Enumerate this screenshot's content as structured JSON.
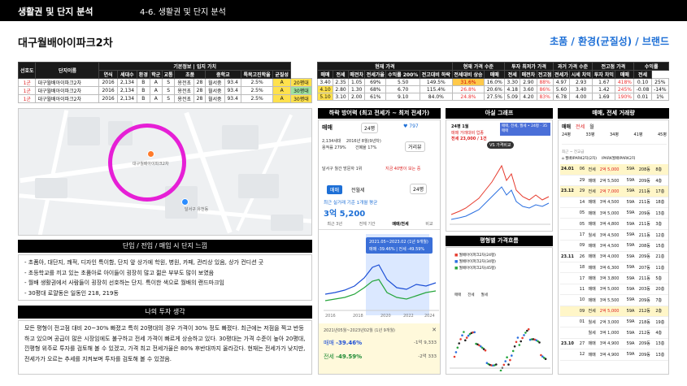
{
  "header": {
    "section": "생활권 및 단지 분석",
    "subsection": "4-6. 생활권 및 단지 분석"
  },
  "page_title": "대구월배아이파크2차",
  "brand_tag": "초품 / 환경(균질성) / 브랜드",
  "left_table": {
    "group_header": "기본정보 | 입지 가치",
    "headers": [
      "선호도",
      "단지이름",
      "연식",
      "세대수",
      "환경",
      "학군",
      "교통",
      "초품",
      "중학교",
      "학원가",
      "특목고진학율",
      "균질성",
      "평형"
    ],
    "rows": [
      {
        "pref": "1군",
        "name": "대구월배아이파크2차",
        "year": "2016",
        "units": "2,134",
        "env": "B",
        "school": "A",
        "traffic": "S",
        "elem": "용전초",
        "dist": "28",
        "middle": "월서중",
        "acad": "93.4",
        "rate": "2.5%",
        "homog": "A",
        "size": "20평대"
      },
      {
        "pref": "1군",
        "name": "대구월배아이파크2차",
        "year": "2016",
        "units": "2,134",
        "env": "B",
        "school": "A",
        "traffic": "S",
        "elem": "용전초",
        "dist": "28",
        "middle": "월서중",
        "acad": "93.4",
        "rate": "2.5%",
        "homog": "A",
        "size": "30평대"
      },
      {
        "pref": "1군",
        "name": "대구월배아이파크2차",
        "year": "2016",
        "units": "2,134",
        "env": "B",
        "school": "A",
        "traffic": "S",
        "elem": "용전초",
        "dist": "28",
        "middle": "월서중",
        "acad": "93.4",
        "rate": "2.5%",
        "homog": "A",
        "size": "30평대"
      }
    ]
  },
  "right_table": {
    "group_headers": [
      "현재 가격",
      "현재 가격 수준",
      "투자 최저가 가격",
      "과거 가격 수준",
      "전고점 가격",
      "수익률"
    ],
    "headers": [
      "매매",
      "전세",
      "매전차",
      "전세가율",
      "수익률 200%",
      "전고대비 하락",
      "전세대비 상승",
      "매매",
      "전세",
      "매전차",
      "전고점",
      "전세가",
      "시세 차익",
      "투자 차익",
      "매매",
      "전세"
    ],
    "rows": [
      [
        "3.40",
        "2.35",
        "1.05",
        "69%",
        "5.50",
        "149.5%",
        "31.6%",
        "16.0%",
        "3.30",
        "2.90",
        "88%",
        "4.97",
        "2.93",
        "1.67",
        "418%",
        "0.10",
        "25%"
      ],
      [
        "4.10",
        "2.80",
        "1.30",
        "68%",
        "6.70",
        "115.4%",
        "26.8%",
        "20.6%",
        "4.18",
        "3.60",
        "86%",
        "5.60",
        "3.40",
        "1.42",
        "245%",
        "-0.08",
        "-14%"
      ],
      [
        "5.10",
        "3.10",
        "2.00",
        "61%",
        "9.10",
        "84.0%",
        "24.8%",
        "27.5%",
        "5.09",
        "4.20",
        "83%",
        "6.78",
        "4.00",
        "1.69",
        "190%",
        "0.01",
        "1%"
      ]
    ]
  },
  "map": {
    "label1": "달서구 유천동",
    "pin_label": "대구월배아이파크2차"
  },
  "feelings": {
    "title": "단임 / 전임 / 매임 시 단지 느낌",
    "items": [
      "- 초품아, 대단지, 쾌적, 디자인 특이함, 단지 앞 상가에 학원, 병원, 카페, 관리상 있음, 상가 컨디션 굿",
      "- 초등학교를 끼고 있는 초품아로 아이들이 굉장히 많고 젊은 부부도 많이 보였음",
      "- 월배 생활권에서 사람들이 굉장히 선호하는 단지. 특이한 색으로 월배의 랜드마크임",
      "- 30평대 로얄동은 일동인 218, 219동"
    ]
  },
  "my_thoughts": {
    "title": "나의 투자 생각",
    "text": "모든 평형이 전고점 대비 20~30% 빠졌고 특히 20평대의 경우 가격이 30% 정도 빠졌다. 최근에는 저점을 찍고 반등하고 있으며 공급이 많은 시장임에도 불구하고 전세 가격이 빠르게 상승하고 있다. 30평대는 가격 수준이 높아 20평대, 낀평형 위주로 투자를 검토해 볼 수 있겠고, 가격 최고 전세가율은 80% 후반대까지 올라갔다. 현재는 전세가가 낮지만, 전세가가 오르는 추세를 지켜보며 투자를 검토해 볼 수 있겠음."
  },
  "drop_panel": {
    "title": "하락 방어력 (최고 전세가 ~ 최저 전세가)",
    "tab_sale": "매매",
    "pyeong": "24평",
    "hearts": "797",
    "units_line": "2,134세대",
    "year_line": "2016년 8월(9년차)",
    "floor_line": "용적률 279%",
    "bldg_line": "건폐율 17%",
    "distance": "거리뷰",
    "sub_note": "달서구 월간 방문자 1위",
    "sub_note2": "지금 40명이 보는 중",
    "pyeong2": "24평",
    "tab_a": "매매",
    "tab_b": "전월세",
    "recent_label": "최근 실거래 기준 1개월 평균",
    "recent_price": "3억 5,200",
    "range_tabs": [
      "최근 3년",
      "전체 기간",
      "매매/전세",
      "비교"
    ],
    "tooltip_title": "2021.05~2023.02 (1년 9개월)",
    "tooltip_line": "매매 -39.46% | 전세 -49.59%",
    "years": [
      "2016",
      "2018",
      "2020",
      "2022",
      "2024"
    ],
    "box_period": "2021년05월~2023년02월 (1년 9개월)",
    "box_sale_label": "매매",
    "box_sale_pct": "-39.46%",
    "box_sale_amt": "-1억 9,333",
    "box_rent_label": "전세",
    "box_rent_pct": "-49.59%",
    "box_rent_amt": "-2억 333"
  },
  "ashil": {
    "title": "아실 그래프",
    "chart_title": "24평 1월",
    "chart_sub": "매매 거래대비 업종",
    "price": "전세 23,000 / 1건",
    "vs_label": "VS 가격비교",
    "legend": "매매, 전세, 월세 • 24평 · 35 매매"
  },
  "price_flow": {
    "title": "평형별 가격흐름",
    "legend": [
      "월배아이파크2차(24평)",
      "월배아이파크2차(34평)",
      "월배아이파크2차(45평)"
    ],
    "tabs": [
      "매매",
      "전세",
      "월세"
    ]
  },
  "trades": {
    "title": "매매, 전세 거래량",
    "tabs": [
      "매매",
      "전세",
      "월"
    ],
    "summary_heads": [
      "24평",
      "33평",
      "34평",
      "41평",
      "45평"
    ],
    "filter": "최근 ~ 전교급",
    "complex": "월배IPARK2차(2차)",
    "complex2": "IPARK월배IPARK2차",
    "rows": [
      {
        "date": "24.01",
        "day": "06",
        "type": "전세",
        "price": "2억 5,000",
        "size": "59A",
        "floor": "208동",
        "fl": "8층"
      },
      {
        "date": "",
        "day": "29",
        "type": "매매",
        "price": "2억 5,500",
        "size": "59A",
        "floor": "209동",
        "fl": "4층"
      },
      {
        "date": "23.12",
        "day": "29",
        "type": "전세",
        "price": "2억 7,000",
        "size": "59A",
        "floor": "211동",
        "fl": "17층"
      },
      {
        "date": "",
        "day": "14",
        "type": "매매",
        "price": "3억 4,500",
        "size": "59A",
        "floor": "211동",
        "fl": "18층"
      },
      {
        "date": "",
        "day": "05",
        "type": "매매",
        "price": "3억 5,000",
        "size": "59A",
        "floor": "209동",
        "fl": "13층"
      },
      {
        "date": "",
        "day": "05",
        "type": "매매",
        "price": "3억 4,800",
        "size": "59A",
        "floor": "211동",
        "fl": "3층"
      },
      {
        "date": "",
        "day": "17",
        "type": "월세",
        "price": "3억 4,500",
        "size": "59A",
        "floor": "211동",
        "fl": "12층"
      },
      {
        "date": "",
        "day": "09",
        "type": "매매",
        "price": "3억 4,500",
        "size": "59A",
        "floor": "208동",
        "fl": "15층"
      },
      {
        "date": "23.11",
        "day": "26",
        "type": "매매",
        "price": "3억 4,000",
        "size": "59A",
        "floor": "209동",
        "fl": "21층"
      },
      {
        "date": "",
        "day": "18",
        "type": "매매",
        "price": "3억 6,300",
        "size": "59A",
        "floor": "207동",
        "fl": "11층"
      },
      {
        "date": "",
        "day": "17",
        "type": "매매",
        "price": "3억 3,800",
        "size": "59A",
        "floor": "211동",
        "fl": "5층"
      },
      {
        "date": "",
        "day": "11",
        "type": "매매",
        "price": "3억 5,000",
        "size": "59A",
        "floor": "203동",
        "fl": "20층"
      },
      {
        "date": "",
        "day": "10",
        "type": "매매",
        "price": "3억 5,500",
        "size": "59A",
        "floor": "209동",
        "fl": "7층"
      },
      {
        "date": "",
        "day": "09",
        "type": "전세",
        "price": "2억 5,000",
        "size": "59A",
        "floor": "212동",
        "fl": "2층"
      },
      {
        "date": "",
        "day": "01",
        "type": "월세",
        "price": "2억 3,000",
        "size": "59A",
        "floor": "218동",
        "fl": "19층"
      },
      {
        "date": "",
        "day": "",
        "type": "월세",
        "price": "3억 1,000",
        "size": "59A",
        "floor": "212동",
        "fl": "4층"
      },
      {
        "date": "23.10",
        "day": "27",
        "type": "매매",
        "price": "3억 4,900",
        "size": "59A",
        "floor": "209동",
        "fl": "13층"
      },
      {
        "date": "",
        "day": "12",
        "type": "매매",
        "price": "3억 4,900",
        "size": "59A",
        "floor": "209동",
        "fl": "13층"
      }
    ]
  }
}
